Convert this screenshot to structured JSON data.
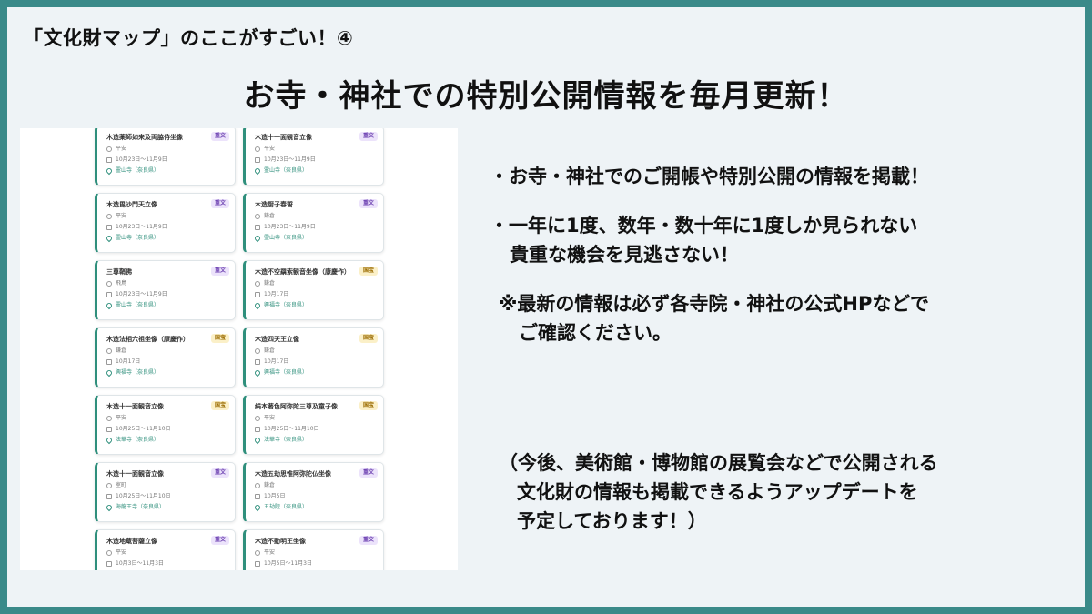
{
  "heading": {
    "small": "「文化財マップ」のここがすごい！④",
    "main": "お寺・神社での特別公開情報を毎月更新！"
  },
  "bullets": {
    "b1": "・お寺・神社でのご開帳や特別公開の情報を掲載！",
    "b2_line1": "・一年に1度、数年・数十年に1度しか見られない",
    "b2_line2": "貴重な機会を見逃さない！",
    "note_line1": "※最新の情報は必ず各寺院・神社の公式HPなどで",
    "note_line2": "ご確認ください。"
  },
  "footnote": {
    "line1": "（今後、美術館・博物館の展覧会などで公開される",
    "line2": "文化財の情報も掲載できるようアップデートを",
    "line3": "予定しております！）"
  },
  "cards": [
    {
      "title": "木造薬師如来及両脇侍坐像",
      "badge": "重文",
      "badge_type": "juubun",
      "era": "平安",
      "date": "10月23日～11月9日",
      "place": "霊山寺（奈良県）"
    },
    {
      "title": "木造十一面観音立像",
      "badge": "重文",
      "badge_type": "juubun",
      "era": "平安",
      "date": "10月23日～11月9日",
      "place": "霊山寺（奈良県）"
    },
    {
      "title": "木造毘沙門天立像",
      "badge": "重文",
      "badge_type": "juubun",
      "era": "平安",
      "date": "10月23日～11月9日",
      "place": "霊山寺（奈良県）"
    },
    {
      "title": "木造厨子春誓",
      "badge": "重文",
      "badge_type": "juubun",
      "era": "鎌倉",
      "date": "10月23日～11月9日",
      "place": "霊山寺（奈良県）"
    },
    {
      "title": "三尊鞘佛",
      "badge": "重文",
      "badge_type": "juubun",
      "era": "飛鳥",
      "date": "10月23日～11月9日",
      "place": "霊山寺（奈良県）"
    },
    {
      "title": "木造不空羂索観音坐像（康慶作）",
      "badge": "国宝",
      "badge_type": "kokuhou",
      "era": "鎌倉",
      "date": "10月17日",
      "place": "興福寺（奈良県）"
    },
    {
      "title": "木造法相六祖坐像（康慶作）",
      "badge": "国宝",
      "badge_type": "kokuhou",
      "era": "鎌倉",
      "date": "10月17日",
      "place": "興福寺（奈良県）"
    },
    {
      "title": "木造四天王立像",
      "badge": "国宝",
      "badge_type": "kokuhou",
      "era": "鎌倉",
      "date": "10月17日",
      "place": "興福寺（奈良県）"
    },
    {
      "title": "木造十一面観音立像",
      "badge": "国宝",
      "badge_type": "kokuhou",
      "era": "平安",
      "date": "10月25日～11月10日",
      "place": "法華寺（奈良県）"
    },
    {
      "title": "絹本著色阿弥陀三尊及童子像",
      "badge": "国宝",
      "badge_type": "kokuhou",
      "era": "平安",
      "date": "10月25日～11月10日",
      "place": "法華寺（奈良県）"
    },
    {
      "title": "木造十一面観音立像",
      "badge": "重文",
      "badge_type": "juubun",
      "era": "室町",
      "date": "10月25日～11月10日",
      "place": "海龍王寺（奈良県）"
    },
    {
      "title": "木造五劫思惟阿弥陀仏坐像",
      "badge": "重文",
      "badge_type": "juubun",
      "era": "鎌倉",
      "date": "10月5日",
      "place": "五劫院（奈良県）"
    },
    {
      "title": "木造地蔵菩薩立像",
      "badge": "重文",
      "badge_type": "juubun",
      "era": "平安",
      "date": "10月3日～11月3日",
      "place": ""
    },
    {
      "title": "木造不動明王坐像",
      "badge": "重文",
      "badge_type": "juubun",
      "era": "平安",
      "date": "10月5日～11月3日",
      "place": ""
    }
  ]
}
